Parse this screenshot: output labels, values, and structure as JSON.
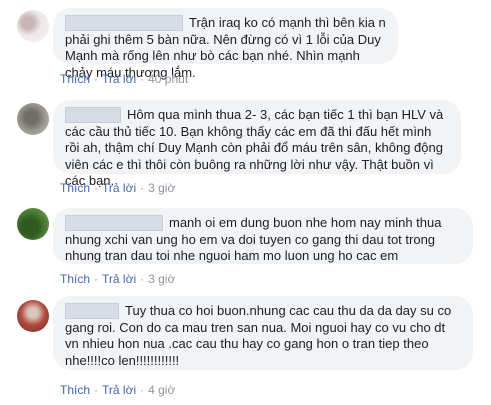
{
  "comments": [
    {
      "text": "Trận iraq ko có mạnh thì bên kia n phải ghi thêm 5 bàn nữa. Nên đừng có vì 1 lỗi của Duy Mạnh mà rống lên như bò các bạn nhé. Nhìn mạnh chảy máu thương lắm.",
      "like_label": "Thích",
      "reply_label": "Trả lời",
      "time": "40 phút",
      "avatar_color": "#e7dfe0"
    },
    {
      "text": "Hôm qua mình thua 2- 3, các bạn tiếc 1 thì bạn HLV và các cầu thủ tiếc 10. Bạn không thấy các em đã thi đấu hết mình rồi ah, thậm chí Duy Mạnh còn phải đổ máu trên sân, không động viên các e thì thôi còn buông ra những lời như vậy. Thật buồn vì các bạn.",
      "like_label": "Thích",
      "reply_label": "Trả lời",
      "time": "3 giờ",
      "avatar_color": "#8c8a84"
    },
    {
      "text": "manh oi em dung buon nhe hom nay minh thua nhung xchi van ung ho em va doi tuyen co gang thi dau tot trong nhung tran dau toi nhe nguoi ham mo luon ung ho cac em",
      "like_label": "Thích",
      "reply_label": "Trả lời",
      "time": "3 giờ",
      "avatar_color": "#3f6b2c"
    },
    {
      "text": "Tuy thua co hoi buon.nhung cac cau thu da da day su co gang roi. Con do ca mau tren san nua. Moi nguoi hay co vu cho dt vn nhieu hon nua .cac cau thu hay co gang hon o tran tiep theo nhe!!!!co len!!!!!!!!!!!!",
      "like_label": "Thích",
      "reply_label": "Trả lời",
      "time": "4 giờ",
      "avatar_color": "#b04a3c"
    }
  ]
}
